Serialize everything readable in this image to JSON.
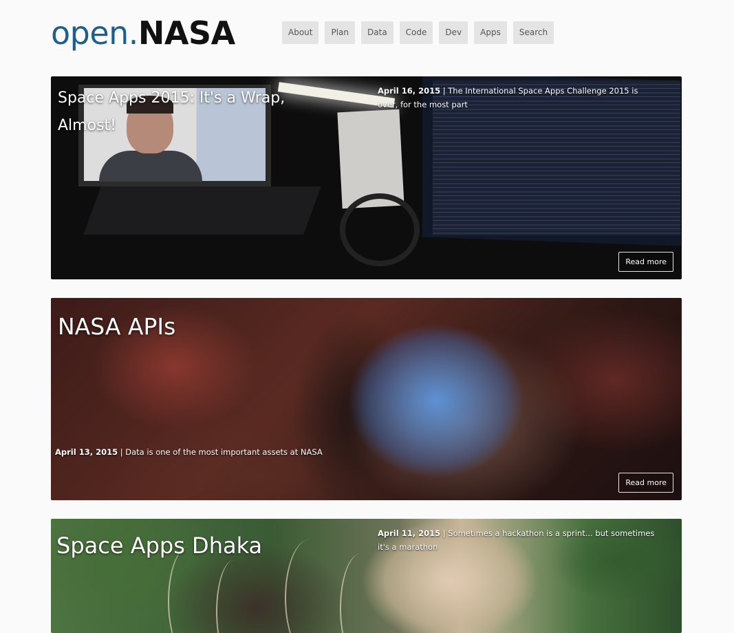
{
  "header": {
    "logo_open": "open.",
    "logo_nasa": "NASA",
    "nav": [
      "About",
      "Plan",
      "Data",
      "Code",
      "Dev",
      "Apps",
      "Search"
    ]
  },
  "posts": [
    {
      "title": "Space Apps 2015: It's a Wrap, Almost!",
      "date": "April 16, 2015",
      "summary": "The International Space Apps Challenge 2015 is over, for the most part",
      "read_more": "Read more"
    },
    {
      "title": "NASA APIs",
      "date": "April 13, 2015",
      "summary": "Data is one of the most important assets at NASA",
      "read_more": "Read more"
    },
    {
      "title": "Space Apps Dhaka",
      "date": "April 11, 2015",
      "summary": "Sometimes a hackathon is a sprint... but sometimes it's a marathon"
    }
  ]
}
